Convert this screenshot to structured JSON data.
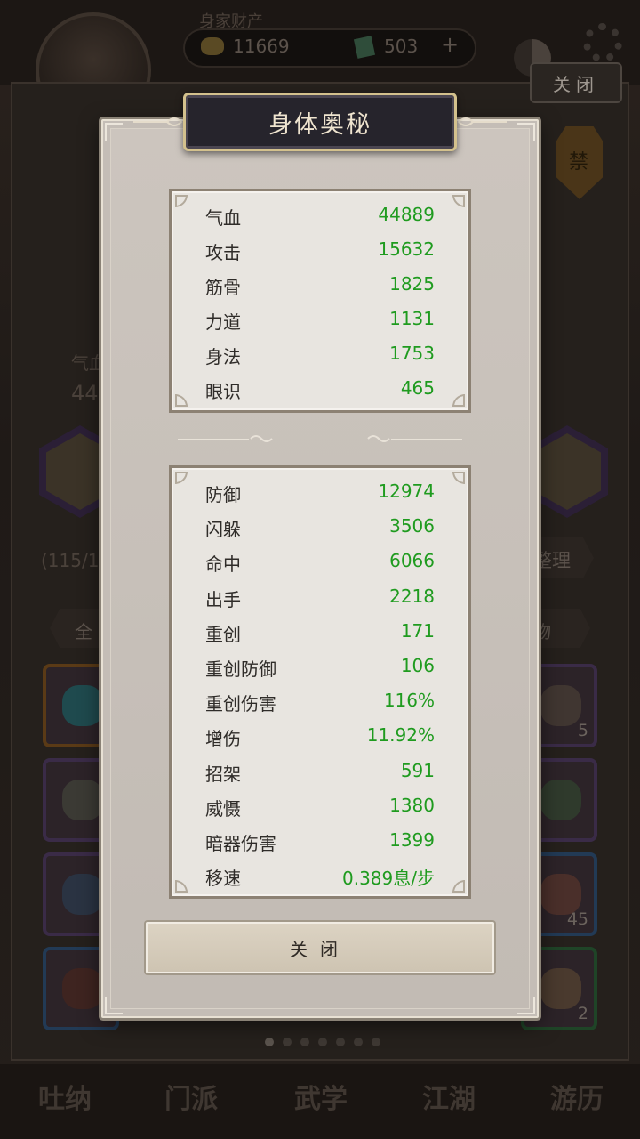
{
  "background": {
    "resource_title": "身家财产",
    "gold": "11669",
    "jade": "503",
    "plus": "+",
    "close_top": "关闭",
    "hp_label_partial": "气血",
    "hp_value_partial": "44",
    "bag_count_partial": "(115/16",
    "sort_label": "整理",
    "filter_all": "全",
    "filter_right": "物",
    "banner_char": "禁",
    "slot_counts": [
      "5",
      "45",
      "2"
    ],
    "nav": [
      "吐纳",
      "门派",
      "武学",
      "江湖",
      "游历"
    ]
  },
  "dialog": {
    "title": "身体奥秘",
    "close_label": "关闭",
    "primary_stats": [
      {
        "label": "气血",
        "value": "44889"
      },
      {
        "label": "攻击",
        "value": "15632"
      },
      {
        "label": "筋骨",
        "value": "1825"
      },
      {
        "label": "力道",
        "value": "1131"
      },
      {
        "label": "身法",
        "value": "1753"
      },
      {
        "label": "眼识",
        "value": "465"
      }
    ],
    "secondary_stats": [
      {
        "label": "防御",
        "value": "12974"
      },
      {
        "label": "闪躲",
        "value": "3506"
      },
      {
        "label": "命中",
        "value": "6066"
      },
      {
        "label": "出手",
        "value": "2218"
      },
      {
        "label": "重创",
        "value": "171"
      },
      {
        "label": "重创防御",
        "value": "106"
      },
      {
        "label": "重创伤害",
        "value": "116%"
      },
      {
        "label": "增伤",
        "value": "11.92%"
      },
      {
        "label": "招架",
        "value": "591"
      },
      {
        "label": "威慑",
        "value": "1380"
      },
      {
        "label": "暗器伤害",
        "value": "1399"
      },
      {
        "label": "移速",
        "value": "0.389息/步"
      }
    ]
  },
  "colors": {
    "stat_value": "#1f9b1f",
    "dialog_bg": "#c4bdb6",
    "title_plate": "#26242c",
    "title_gold": "#d3c18d"
  },
  "icons": [
    "coin-icon",
    "jade-icon",
    "plus-icon",
    "yinyang-icon",
    "gear-icon",
    "banner-icon"
  ]
}
